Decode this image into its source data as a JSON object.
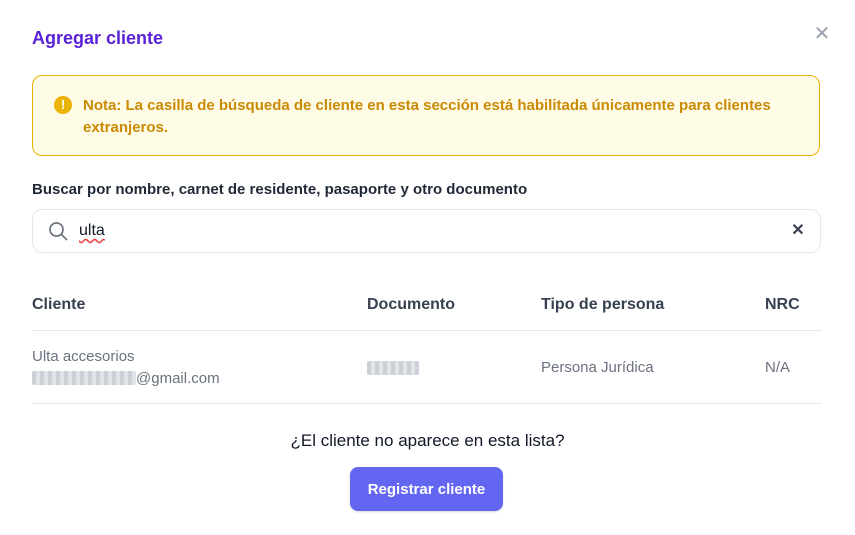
{
  "dialog": {
    "title": "Agregar cliente",
    "close_icon": "close-icon"
  },
  "note": {
    "icon": "warning-circle-icon",
    "text": "Nota: La casilla de búsqueda de cliente en esta sección está habilitada únicamente para clientes extranjeros."
  },
  "search": {
    "label": "Buscar por nombre, carnet de residente, pasaporte y otro documento",
    "value": "ulta",
    "icon": "search-icon",
    "clear_icon": "clear-icon"
  },
  "table": {
    "headers": [
      "Cliente",
      "Documento",
      "Tipo de persona",
      "NRC"
    ],
    "rows": [
      {
        "name": "Ulta accesorios",
        "email_suffix": "@gmail.com",
        "document": "",
        "person_type": "Persona Jurídica",
        "nrc": "N/A"
      }
    ]
  },
  "footer": {
    "question": "¿El cliente no aparece en esta lista?",
    "register_label": "Registrar cliente"
  },
  "colors": {
    "title": "#5b21d6",
    "note_bg": "#fefbe6",
    "note_border": "#eab308",
    "note_text": "#ca8a04",
    "primary_button": "#6366f1"
  }
}
